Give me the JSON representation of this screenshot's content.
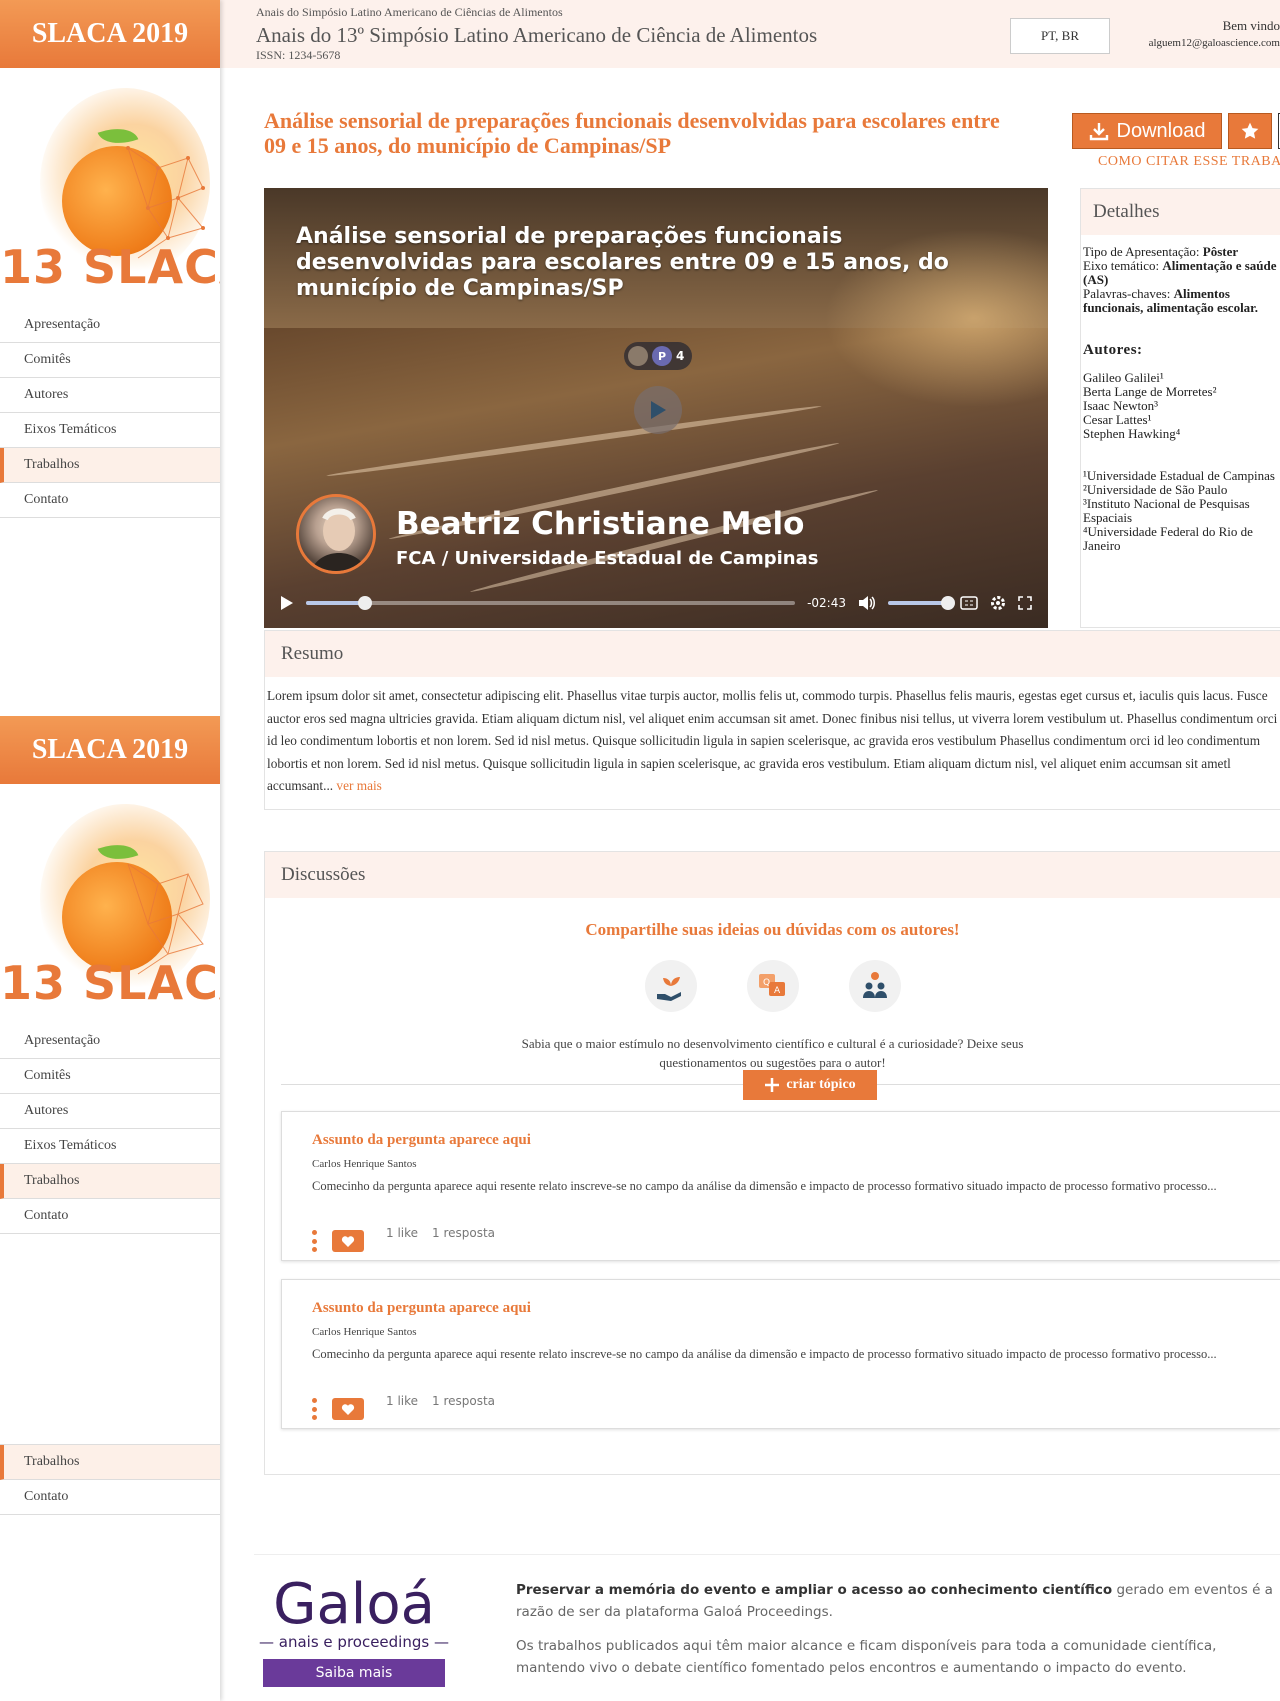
{
  "brand": "SLACA 2019",
  "logo_text": "13 SLACA",
  "nav": [
    "Apresentação",
    "Comitês",
    "Autores",
    "Eixos Temáticos",
    "Trabalhos",
    "Contato"
  ],
  "nav_tail": [
    "Trabalhos",
    "Contato"
  ],
  "header": {
    "kicker": "Anais do Simpósio Latino Americano de Ciências de Alimentos",
    "title": "Anais do 13º Simpósio Latino Americano de Ciência de Alimentos",
    "issn": "ISSN: 1234-5678",
    "language": "PT, BR",
    "welcome": "Bem vindo",
    "email": "alguem12@galoascience.com"
  },
  "paper": {
    "title": "Análise sensorial de preparações funcionais desenvolvidas para escolares entre 09 e 15 anos, do município de Campinas/SP",
    "download_label": "Download",
    "cite_label": "COMO CITAR ESSE TRABALHO"
  },
  "video": {
    "title": "Análise sensorial de preparações funcionais desenvolvidas para escolares entre 09 e 15 anos, do município de Campinas/SP",
    "viewer_initial": "P",
    "viewer_count": "4",
    "presenter": "Beatriz Christiane Melo",
    "affiliation": "FCA / Universidade Estadual de Campinas",
    "time_remaining": "-02:43",
    "progress": 0.12,
    "volume": 1.0
  },
  "details": {
    "heading": "Detalhes",
    "type_label": "Tipo de Apresentação:",
    "type_value": "Pôster",
    "axis_label": "Eixo temático:",
    "axis_value": "Alimentação e saúde (AS)",
    "keywords_label": "Palavras-chaves:",
    "keywords_value": "Alimentos funcionais, alimentação escolar.",
    "authors_heading": "Autores:",
    "authors": [
      "Galileo Galilei¹",
      "Berta Lange de Morretes²",
      "Isaac Newton³",
      "Cesar Lattes¹",
      "Stephen Hawking⁴"
    ],
    "institutions": [
      "¹Universidade Estadual de Campinas",
      "²Universidade de São Paulo",
      "³Instituto Nacional de Pesquisas Espaciais",
      "⁴Universidade Federal do Rio de Janeiro"
    ]
  },
  "resumo": {
    "heading": "Resumo",
    "text": "Lorem ipsum dolor sit amet, consectetur adipiscing elit. Phasellus vitae turpis auctor, mollis felis ut, commodo turpis. Phasellus felis mauris, egestas eget cursus et, iaculis quis lacus. Fusce auctor eros sed magna ultricies gravida. Etiam aliquam dictum nisl, vel aliquet enim accumsan sit amet. Donec finibus nisi tellus, ut viverra lorem vestibulum ut. Phasellus condimentum orci id leo condimentum lobortis et non lorem. Sed id nisl metus. Quisque sollicitudin ligula in sapien scelerisque, ac gravida eros vestibulum Phasellus condimentum orci id leo condimentum lobortis et non lorem. Sed id nisl metus. Quisque sollicitudin ligula in sapien scelerisque, ac gravida eros vestibulum. Etiam aliquam dictum nisl, vel aliquet enim accumsan sit ametl accumsant...",
    "more": "ver mais"
  },
  "discussions": {
    "heading": "Discussões",
    "call": "Compartilhe suas ideias ou dúvidas com os autores!",
    "text": "Sabia que o maior estímulo no desenvolvimento científico e cultural é a curiosidade? Deixe seus questionamentos ou sugestões para o autor!",
    "create_label": "criar tópico",
    "topics": [
      {
        "title": "Assunto da pergunta aparece aqui",
        "author": "Carlos Henrique Santos",
        "body": "Comecinho da pergunta aparece aqui resente relato inscreve-se no campo da análise da dimensão e impacto de processo formativo situado impacto de processo formativo processo...",
        "likes": "1 like",
        "replies": "1 resposta"
      },
      {
        "title": "Assunto da pergunta aparece aqui",
        "author": "Carlos Henrique Santos",
        "body": "Comecinho da pergunta aparece aqui resente relato inscreve-se no campo da análise da dimensão e impacto de processo formativo situado impacto de processo formativo processo...",
        "likes": "1 like",
        "replies": "1 resposta"
      }
    ]
  },
  "footer": {
    "brand": "Galoá",
    "brand_sub": "anais e proceedings",
    "cta": "Saiba mais",
    "lead_bold": "Preservar a memória do evento e ampliar o acesso ao conhecimento científico",
    "lead_rest": " gerado em eventos é a razão de ser da plataforma Galoá Proceedings.",
    "text2": "Os trabalhos publicados aqui têm maior alcance e ficam disponíveis para toda a comunidade científica, mantendo vivo o debate científico fomentado pelos encontros e aumentando o impacto do evento."
  }
}
